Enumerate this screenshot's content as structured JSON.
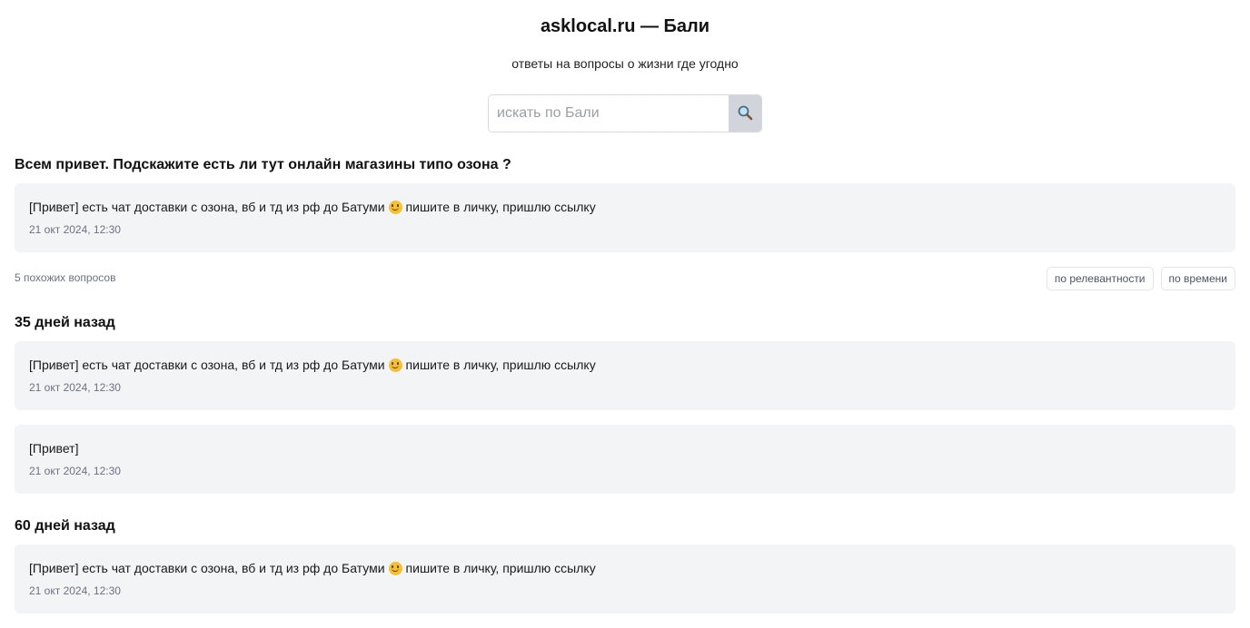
{
  "header": {
    "title": "asklocal.ru — Бали",
    "tagline": "ответы на вопросы о жизни где угодно"
  },
  "search": {
    "placeholder": "искать по Бали",
    "value": "",
    "button_icon": "search-icon"
  },
  "question": {
    "title": "Всем привет. Подскажите есть ли тут онлайн магазины типо озона ?",
    "answer": {
      "text_before": "[Привет] есть чат доставки с озона, вб и тд из рф до Батуми",
      "text_after": "пишите в личку, пришлю ссылку",
      "emoji": "smiling-face-icon",
      "date": "21 окт 2024, 12:30"
    }
  },
  "similar": {
    "count_label": "5 похожих вопросов",
    "sort_relevance": "по релевантности",
    "sort_time": "по времени"
  },
  "groups": [
    {
      "heading": "35 дней назад",
      "items": [
        {
          "text_before": "[Привет] есть чат доставки с озона, вб и тд из рф до Батуми",
          "text_after": "пишите в личку, пришлю ссылку",
          "date": "21 окт 2024, 12:30"
        },
        {
          "text": "[Привет]",
          "date": "21 окт 2024, 12:30"
        }
      ]
    },
    {
      "heading": "60 дней назад",
      "items": [
        {
          "text_before": "[Привет] есть чат доставки с озона, вб и тд из рф до Батуми",
          "text_after": "пишите в личку, пришлю ссылку",
          "date": "21 окт 2024, 12:30"
        }
      ]
    }
  ],
  "colors": {
    "card_background": "#f3f4f6",
    "muted_text": "#6b7280",
    "search_button": "#d1d5db"
  }
}
